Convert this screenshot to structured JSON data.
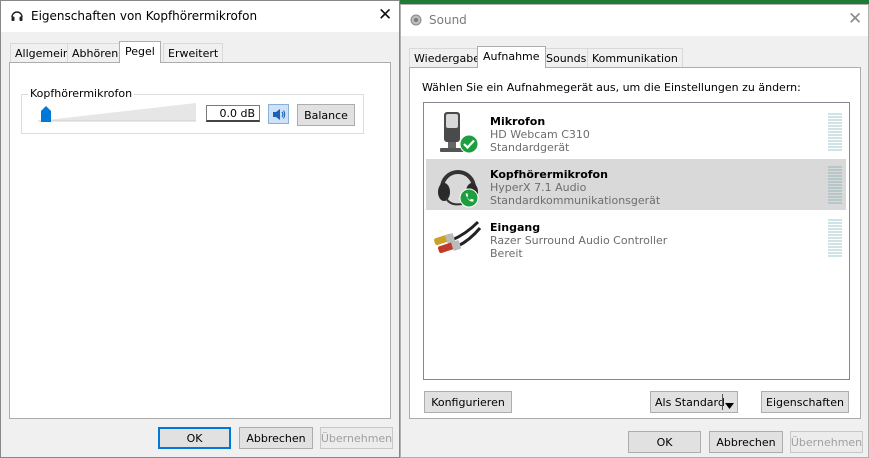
{
  "left_window": {
    "title": "Eigenschaften von Kopfhörermikrofon",
    "tabs": [
      {
        "label": "Allgemein",
        "active": false
      },
      {
        "label": "Abhören",
        "active": false
      },
      {
        "label": "Pegel",
        "active": true
      },
      {
        "label": "Erweitert",
        "active": false
      }
    ],
    "group_label": "Kopfhörermikrofon",
    "level_value": "0.0 dB",
    "slider_level_percent": 0,
    "balance_label": "Balance",
    "buttons": {
      "ok": "OK",
      "cancel": "Abbrechen",
      "apply": "Übernehmen"
    }
  },
  "right_window": {
    "title": "Sound",
    "tabs": [
      {
        "label": "Wiedergabe",
        "active": false
      },
      {
        "label": "Aufnahme",
        "active": true
      },
      {
        "label": "Sounds",
        "active": false
      },
      {
        "label": "Kommunikation",
        "active": false
      }
    ],
    "instruction": "Wählen Sie ein Aufnahmegerät aus, um die Einstellungen zu ändern:",
    "devices": [
      {
        "name": "Mikrofon",
        "model": "HD Webcam C310",
        "status": "Standardgerät",
        "selected": false,
        "icon": "microphone-icon",
        "badge": "checkmark-badge-icon"
      },
      {
        "name": "Kopfhörermikrofon",
        "model": "HyperX 7.1 Audio",
        "status": "Standardkommunikationsgerät",
        "selected": true,
        "icon": "headset-icon",
        "badge": "phone-badge-icon"
      },
      {
        "name": "Eingang",
        "model": "Razer Surround Audio Controller",
        "status": "Bereit",
        "selected": false,
        "icon": "rca-cable-icon",
        "badge": ""
      }
    ],
    "buttons": {
      "configure": "Konfigurieren",
      "set_default": "Als Standard",
      "properties": "Eigenschaften",
      "ok": "OK",
      "cancel": "Abbrechen",
      "apply": "Übernehmen"
    }
  },
  "colors": {
    "accent": "#0078d7",
    "badge_green": "#1e9e3e",
    "selected_row": "#d9d9d9",
    "background_app": "#1f7a33"
  }
}
